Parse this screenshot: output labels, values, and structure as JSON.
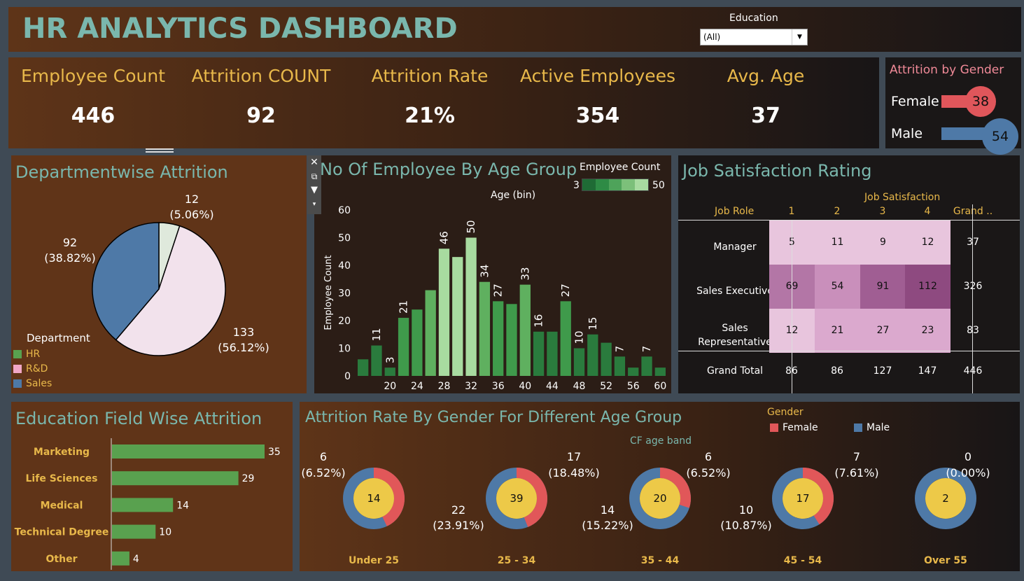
{
  "header": {
    "title": "HR ANALYTICS DASHBOARD",
    "filter_label": "Education",
    "filter_value": "(All)"
  },
  "kpis": [
    {
      "label": "Employee Count",
      "value": "446"
    },
    {
      "label": "Attrition COUNT",
      "value": "92"
    },
    {
      "label": "Attrition Rate",
      "value": "21%"
    },
    {
      "label": "Active Employees",
      "value": "354"
    },
    {
      "label": "Avg. Age",
      "value": "37"
    }
  ],
  "gender_attrition": {
    "title": "Attrition by Gender",
    "rows": [
      {
        "label": "Female",
        "value": "38",
        "color": "#e0565b"
      },
      {
        "label": "Male",
        "value": "54",
        "color": "#4e79a7"
      }
    ]
  },
  "department": {
    "title": "Departmentwise Attrition",
    "legend_title": "Department",
    "legend": [
      {
        "label": "HR",
        "color": "#59a14f"
      },
      {
        "label": "R&D",
        "color": "#f1a7c6"
      },
      {
        "label": "Sales",
        "color": "#4e79a7"
      }
    ],
    "labels": [
      {
        "count": "12",
        "pct": "(5.06%)"
      },
      {
        "count": "92",
        "pct": "(38.82%)"
      },
      {
        "count": "133",
        "pct": "(56.12%)"
      }
    ]
  },
  "age_group": {
    "title": "No Of Employee By Age Group",
    "legend_title": "Employee Count",
    "legend_min": "3",
    "legend_max": "50",
    "x_title": "Age (bin)",
    "y_title": "Employee Count",
    "y_ticks": [
      "0",
      "10",
      "20",
      "30",
      "40",
      "50",
      "60"
    ],
    "x_ticks": [
      "20",
      "24",
      "28",
      "32",
      "36",
      "40",
      "44",
      "48",
      "52",
      "56",
      "60"
    ],
    "tool_icons": [
      "close-icon",
      "popout-icon",
      "filter-icon",
      "dropdown-icon"
    ]
  },
  "job_satisfaction": {
    "title": "Job Satisfaction Rating",
    "col_group": "Job Satisfaction",
    "row_header": "Job Role",
    "columns": [
      "1",
      "2",
      "3",
      "4",
      "Grand .."
    ],
    "rows": [
      {
        "role": "Manager",
        "values": [
          "5",
          "11",
          "9",
          "12"
        ],
        "total": "37"
      },
      {
        "role": "Sales Executive",
        "values": [
          "69",
          "54",
          "91",
          "112"
        ],
        "total": "326"
      },
      {
        "role": "Sales\nRepresentative",
        "values": [
          "12",
          "21",
          "27",
          "23"
        ],
        "total": "83"
      }
    ],
    "grand": {
      "role": "Grand Total",
      "values": [
        "86",
        "86",
        "127",
        "147"
      ],
      "total": "446"
    }
  },
  "education_field": {
    "title": "Education Field Wise Attrition",
    "bar_color": "#59a14f"
  },
  "gender_age": {
    "title": "Attrition Rate By Gender For Different Age Group",
    "band_title": "CF age band",
    "legend_title": "Gender",
    "legend": [
      {
        "label": "Female",
        "color": "#e15759"
      },
      {
        "label": "Male",
        "color": "#4e79a7"
      }
    ],
    "groups": [
      {
        "band": "Under 25",
        "total": "14",
        "female": 0.43,
        "top_count": "6",
        "top_pct": "(6.52%)",
        "bottom_count": "",
        "bottom_pct": ""
      },
      {
        "band": "25 - 34",
        "total": "39",
        "female": 0.44,
        "top_count": "17",
        "top_pct": "(18.48%)",
        "bottom_count": "22",
        "bottom_pct": "(23.91%)"
      },
      {
        "band": "35 - 44",
        "total": "20",
        "female": 0.3,
        "top_count": "6",
        "top_pct": "(6.52%)",
        "bottom_count": "14",
        "bottom_pct": "(15.22%)"
      },
      {
        "band": "45 - 54",
        "total": "17",
        "female": 0.41,
        "top_count": "7",
        "top_pct": "(7.61%)",
        "bottom_count": "10",
        "bottom_pct": "(10.87%)"
      },
      {
        "band": "Over 55",
        "total": "2",
        "female": 0.0,
        "top_count": "0",
        "top_pct": "(0.00%)",
        "bottom_count": "",
        "bottom_pct": ""
      }
    ]
  },
  "chart_data": [
    {
      "type": "pie",
      "title": "Departmentwise Attrition",
      "categories": [
        "HR",
        "R&D",
        "Sales"
      ],
      "values": [
        12,
        133,
        92
      ],
      "colors": [
        "#dfe9dc",
        "#f2e2ec",
        "#4e79a7"
      ]
    },
    {
      "type": "bar",
      "title": "No Of Employee By Age Group",
      "xlabel": "Age (bin)",
      "ylabel": "Employee Count",
      "ylim": [
        0,
        60
      ],
      "x": [
        18,
        19,
        20,
        21,
        22,
        23,
        24,
        25,
        26,
        27,
        28,
        29,
        30,
        31,
        32,
        33,
        34,
        35,
        36,
        37,
        38,
        39,
        40,
        41,
        42
      ],
      "values": [
        6,
        11,
        3,
        21,
        24,
        31,
        46,
        43,
        50,
        34,
        27,
        26,
        33,
        16,
        16,
        27,
        10,
        15,
        12,
        7,
        3,
        7,
        3,
        0,
        0
      ],
      "labels": [
        "",
        "11",
        "3",
        "21",
        "",
        "",
        "46",
        "",
        "50",
        "34",
        "27",
        "",
        "33",
        "16",
        "",
        "27",
        "10",
        "15",
        "",
        "7",
        "",
        "7",
        "",
        "",
        ""
      ]
    },
    {
      "type": "bar",
      "title": "Education Field Wise Attrition",
      "categories": [
        "Marketing",
        "Life Sciences",
        "Medical",
        "Technical Degree",
        "Other"
      ],
      "values": [
        35,
        29,
        14,
        10,
        4
      ]
    },
    {
      "type": "pie",
      "title": "Attrition Rate By Gender For Different Age Group",
      "categories": [
        "Under 25",
        "25 - 34",
        "35 - 44",
        "45 - 54",
        "Over 55"
      ],
      "series": [
        {
          "name": "Female",
          "values": [
            6,
            17,
            6,
            7,
            0
          ]
        },
        {
          "name": "Male",
          "values": [
            8,
            22,
            14,
            10,
            2
          ]
        }
      ]
    }
  ]
}
